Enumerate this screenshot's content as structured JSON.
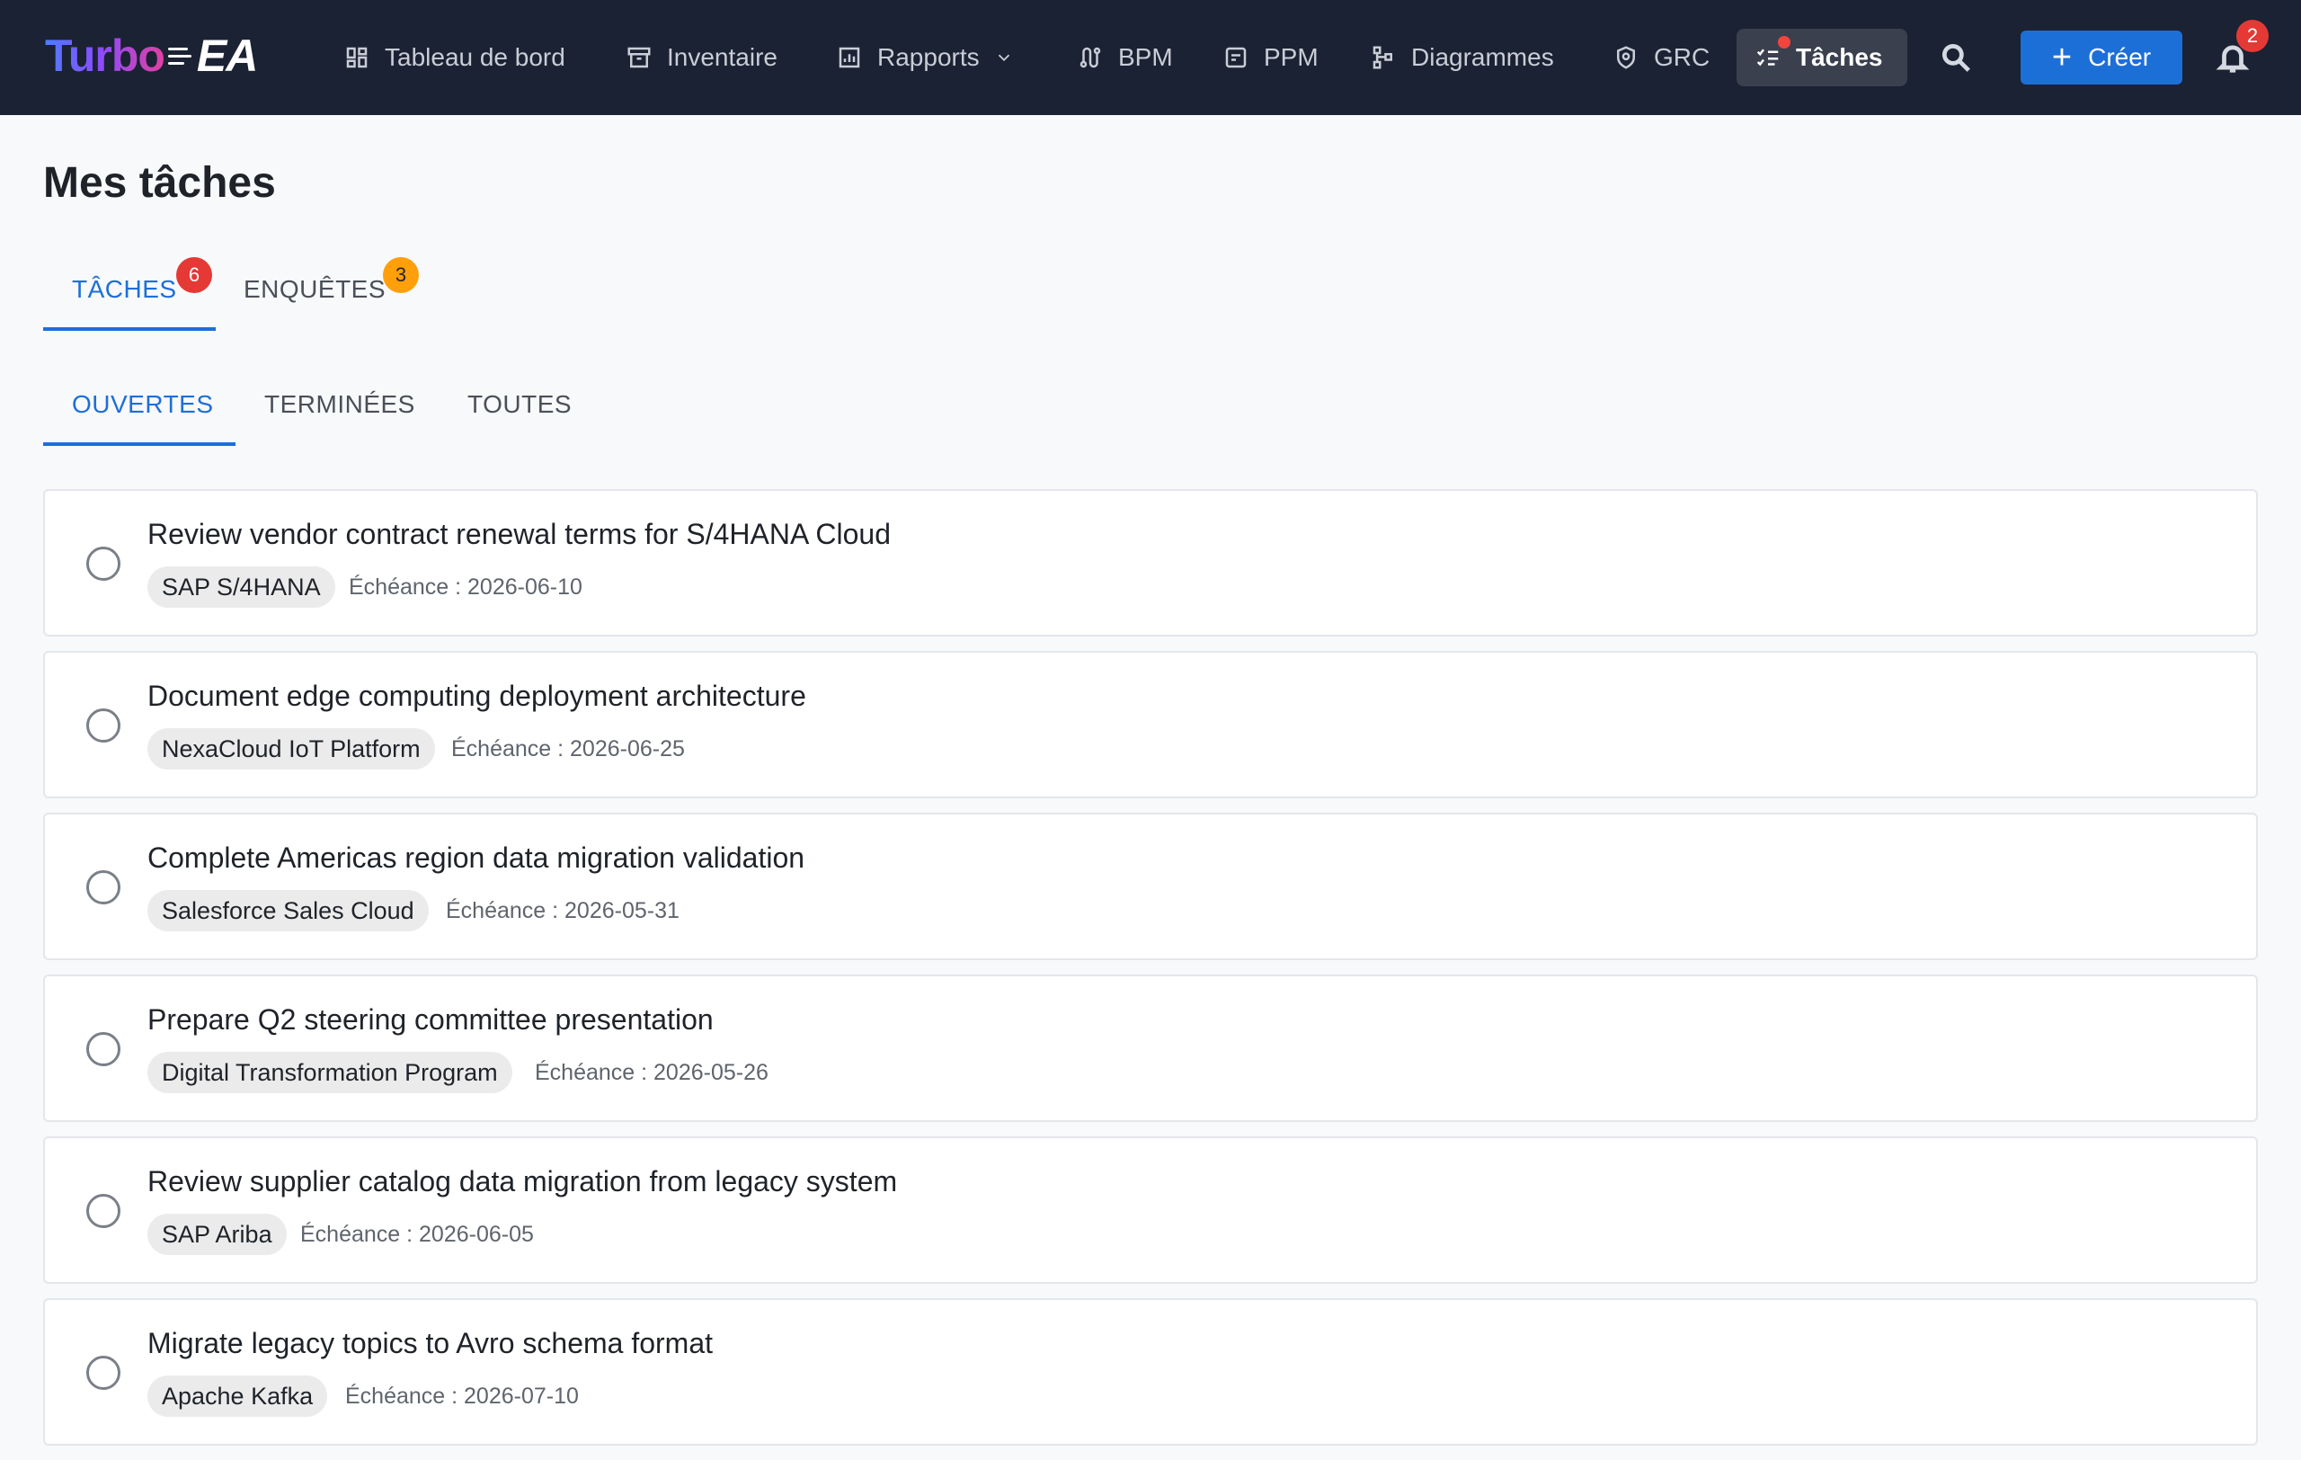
{
  "app": {
    "logo_turbo": "Turbo",
    "logo_ea": "EA"
  },
  "nav": {
    "items": [
      {
        "label": "Tableau de bord",
        "icon": "dashboard-icon"
      },
      {
        "label": "Inventaire",
        "icon": "archive-icon"
      },
      {
        "label": "Rapports",
        "icon": "bar-chart-icon"
      },
      {
        "label": "BPM",
        "icon": "route-icon"
      },
      {
        "label": "PPM",
        "icon": "project-icon"
      },
      {
        "label": "Diagrammes",
        "icon": "hierarchy-icon"
      },
      {
        "label": "GRC",
        "icon": "shield-icon"
      },
      {
        "label": "Tâches",
        "icon": "checklist-icon",
        "active": true
      }
    ],
    "create_label": "Créer",
    "notification_count": "2"
  },
  "page": {
    "title": "Mes tâches"
  },
  "primary_tabs": [
    {
      "label": "TÂCHES",
      "count": "6",
      "active": true
    },
    {
      "label": "ENQUÊTES",
      "count": "3",
      "active": false
    }
  ],
  "secondary_tabs": [
    {
      "label": "OUVERTES",
      "active": true
    },
    {
      "label": "TERMINÉES",
      "active": false
    },
    {
      "label": "TOUTES",
      "active": false
    }
  ],
  "tasks": [
    {
      "title": "Review vendor contract renewal terms for S/4HANA Cloud",
      "tag": "SAP S/4HANA",
      "due": "Échéance : 2026-06-10"
    },
    {
      "title": "Document edge computing deployment architecture",
      "tag": "NexaCloud IoT Platform",
      "due": "Échéance : 2026-06-25"
    },
    {
      "title": "Complete Americas region data migration validation",
      "tag": "Salesforce Sales Cloud",
      "due": "Échéance : 2026-05-31"
    },
    {
      "title": "Prepare Q2 steering committee presentation",
      "tag": "Digital Transformation Program",
      "due": "Échéance : 2026-05-26"
    },
    {
      "title": "Review supplier catalog data migration from legacy system",
      "tag": "SAP Ariba",
      "due": "Échéance : 2026-06-05"
    },
    {
      "title": "Migrate legacy topics to Avro schema format",
      "tag": "Apache Kafka",
      "due": "Échéance : 2026-07-10"
    }
  ],
  "colors": {
    "topbar": "#1b2233",
    "accent": "#1d6fd8",
    "badge_red": "#e53935",
    "badge_orange": "#ff9f0a"
  }
}
